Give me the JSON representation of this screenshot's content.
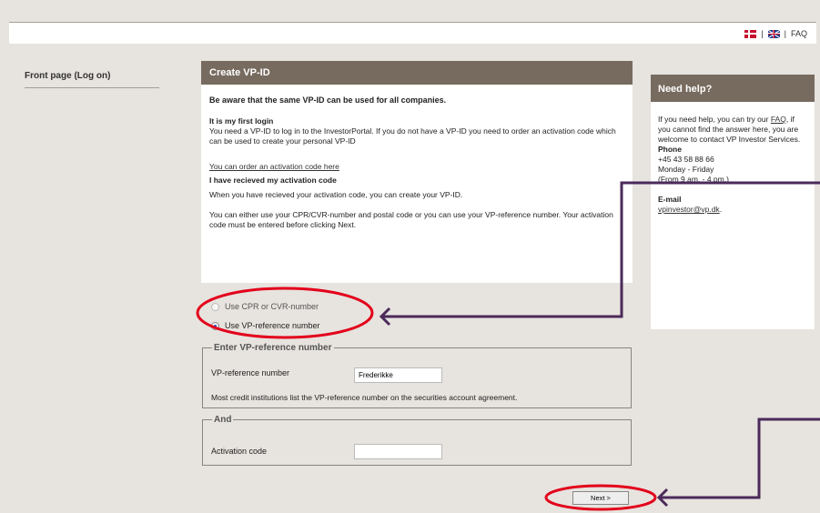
{
  "header": {
    "language_separator_1": "|",
    "language_separator_2": "|",
    "faq_label": "FAQ"
  },
  "sidebar": {
    "items": [
      {
        "label": "Front page (Log on)"
      }
    ]
  },
  "main": {
    "title": "Create VP-ID",
    "warning": "Be aware that the same VP-ID can be used for all companies.",
    "first_login_heading": "It is my first login",
    "first_login_text": "You need a VP-ID to log in to the InvestorPortal. If you do not have a VP-ID you need to order an activation code which can be used to create your personal VP-ID",
    "order_link": "You can order an activation code here",
    "received_heading": "I have recieved my activation code",
    "received_text": "When you have recieved your activation code, you can create your VP-ID.",
    "either_text": "You can either use your CPR/CVR-number and postal code or you can use your VP-reference number. Your activation code must be entered before clicking Next.",
    "radio_options": [
      {
        "label": "Use CPR or CVR-number",
        "selected": false
      },
      {
        "label": "Use VP-reference number",
        "selected": true
      }
    ],
    "vpref_fieldset": {
      "legend": "Enter VP-reference number",
      "field_label": "VP-reference number",
      "field_value": "Frederikke",
      "note": "Most credit institutions list the VP-reference number on the securities account agreement."
    },
    "and_fieldset": {
      "legend": "And",
      "field_label": "Activation code",
      "field_value": ""
    },
    "next_button": "Next >"
  },
  "help": {
    "title": "Need help?",
    "text_1": "If you need help, you can try our",
    "faq_link": "FAQ",
    "text_2": ", if you cannot find the answer here, you are welcome to contact VP Investor Services.",
    "phone_heading": "Phone",
    "phone_number": "+45 43 58 88 66",
    "hours_days": "Monday - Friday",
    "hours_time": "(From 9 am. - 4 pm.)",
    "email_heading": "E-mail",
    "email": "vpinvestor@vp.dk",
    "email_suffix": "."
  },
  "colors": {
    "panel_header": "#776b60",
    "page_background": "#e7e3de",
    "annotation_red": "#e3001b",
    "annotation_purple": "#4b2a5a"
  }
}
